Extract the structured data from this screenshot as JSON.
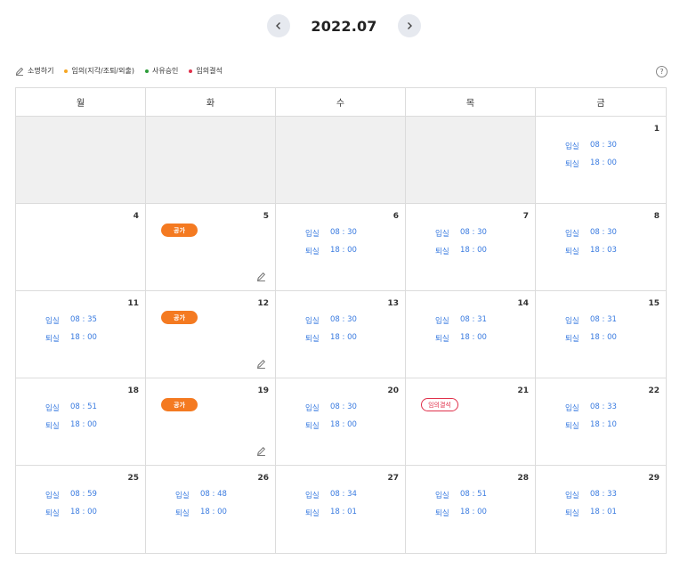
{
  "nav": {
    "month": "2022.07",
    "prev_icon": "chevron-left-icon",
    "next_icon": "chevron-right-icon"
  },
  "legend": {
    "edit": "소명하기",
    "irregular": "임의(지각/조퇴/외출)",
    "excused": "사유승인",
    "unexcused": "임의결석",
    "colors": {
      "irregular": "#f5a623",
      "excused": "#2e9d3a",
      "unexcused": "#e0314b"
    }
  },
  "help": "?",
  "weekdays": [
    "월",
    "화",
    "수",
    "목",
    "금"
  ],
  "labels": {
    "in": "입실",
    "out": "퇴실",
    "vacation": "공가",
    "absent": "임의결석"
  },
  "weeks": [
    [
      {
        "empty": true
      },
      {
        "empty": true
      },
      {
        "empty": true
      },
      {
        "empty": true
      },
      {
        "day": "1",
        "in": "08 : 30",
        "out": "18 : 00"
      }
    ],
    [
      {
        "day": "4"
      },
      {
        "day": "5",
        "vacation": true,
        "edit": true
      },
      {
        "day": "6",
        "in": "08 : 30",
        "out": "18 : 00"
      },
      {
        "day": "7",
        "in": "08 : 30",
        "out": "18 : 00"
      },
      {
        "day": "8",
        "in": "08 : 30",
        "out": "18 : 03"
      }
    ],
    [
      {
        "day": "11",
        "in": "08 : 35",
        "out": "18 : 00"
      },
      {
        "day": "12",
        "vacation": true,
        "edit": true
      },
      {
        "day": "13",
        "in": "08 : 30",
        "out": "18 : 00"
      },
      {
        "day": "14",
        "in": "08 : 31",
        "out": "18 : 00"
      },
      {
        "day": "15",
        "in": "08 : 31",
        "out": "18 : 00"
      }
    ],
    [
      {
        "day": "18",
        "in": "08 : 51",
        "out": "18 : 00"
      },
      {
        "day": "19",
        "vacation": true,
        "edit": true
      },
      {
        "day": "20",
        "in": "08 : 30",
        "out": "18 : 00"
      },
      {
        "day": "21",
        "absent": true
      },
      {
        "day": "22",
        "in": "08 : 33",
        "out": "18 : 10"
      }
    ],
    [
      {
        "day": "25",
        "in": "08 : 59",
        "out": "18 : 00"
      },
      {
        "day": "26",
        "in": "08 : 48",
        "out": "18 : 00",
        "indent": true
      },
      {
        "day": "27",
        "in": "08 : 34",
        "out": "18 : 01"
      },
      {
        "day": "28",
        "in": "08 : 51",
        "out": "18 : 00"
      },
      {
        "day": "29",
        "in": "08 : 33",
        "out": "18 : 01"
      }
    ]
  ]
}
